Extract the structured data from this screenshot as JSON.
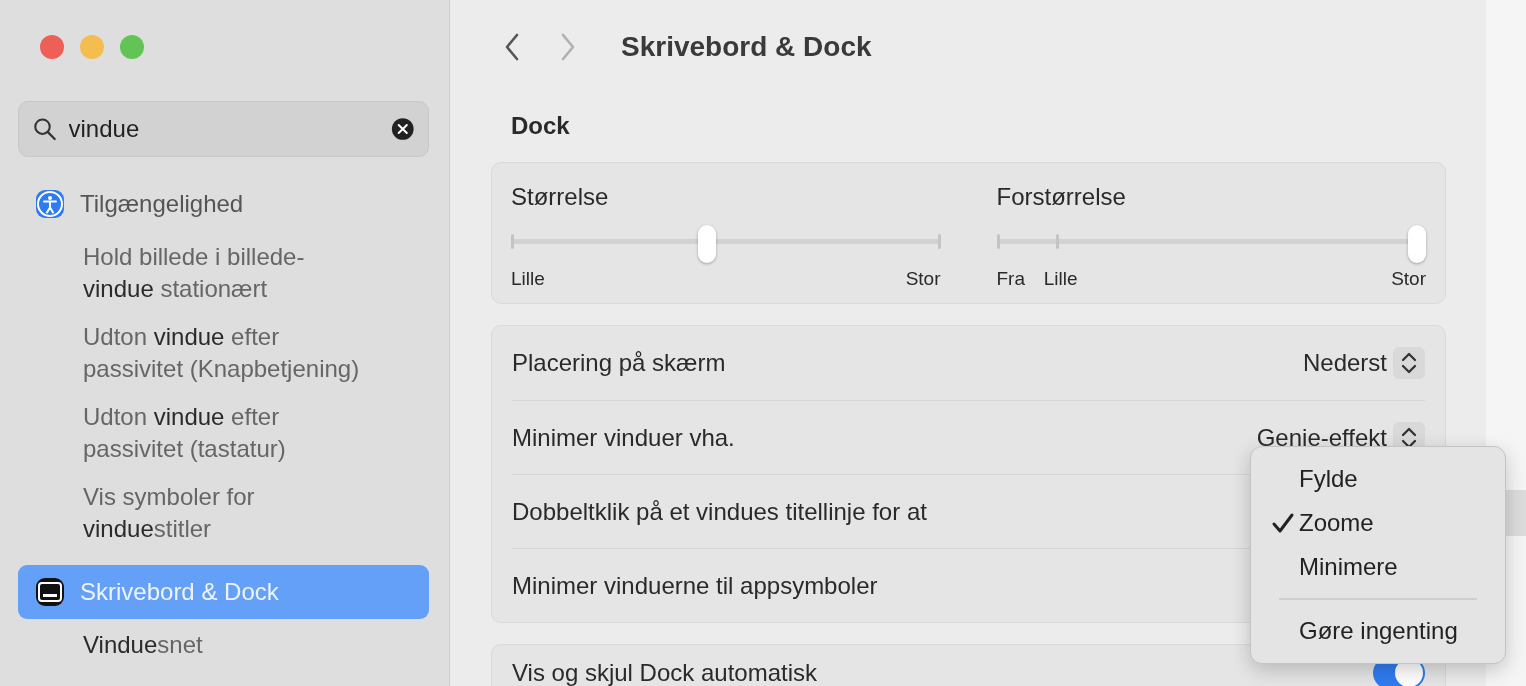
{
  "sidebar": {
    "search": {
      "value": "vindue"
    },
    "items": [
      {
        "label": "Tilgængelighed",
        "selected": false,
        "children": [
          {
            "label": "Hold billede i billede-**vindue** stationært"
          },
          {
            "label": "Udton **vindue** efter passivitet (Knapbetjening)"
          },
          {
            "label": "Udton **vindue** efter passivitet (tastatur)"
          },
          {
            "label": "Vis symboler for **vindue**stitler"
          }
        ]
      },
      {
        "label": "Skrivebord & Dock",
        "selected": true,
        "children": [
          {
            "label": "**Vindue**snet"
          }
        ]
      }
    ]
  },
  "header": {
    "back": {
      "disabled": false
    },
    "forward": {
      "disabled": true
    },
    "title": "Skrivebord & Dock"
  },
  "dock": {
    "title": "Dock",
    "sliders": [
      {
        "label": "Størrelse",
        "level": 0.455,
        "marks": [
          "Lille",
          "Stor"
        ]
      },
      {
        "label": "Forstørrelse",
        "level": 1,
        "marks": [
          "Fra",
          "Lille",
          "Stor"
        ]
      }
    ],
    "rows": [
      {
        "label": "Placering på skærm",
        "kind": "popup",
        "value": "Nederst"
      },
      {
        "label": "Minimer vinduer vha.",
        "kind": "popup",
        "value": "Genie-effekt"
      },
      {
        "label": "Dobbeltklik på et vindues titellinje for at"
      },
      {
        "label": "Minimer vinduerne til appsymboler"
      }
    ],
    "rows_2": [
      {
        "label": "Vis og skjul Dock automatisk",
        "kind": "toggle",
        "on": true
      }
    ]
  },
  "menu": {
    "items": [
      {
        "kind": "item",
        "label": "Fylde",
        "checked": false
      },
      {
        "kind": "item",
        "label": "Zoome",
        "checked": true
      },
      {
        "kind": "item",
        "label": "Minimere",
        "checked": false
      },
      {
        "kind": "separator"
      },
      {
        "kind": "item",
        "label": "Gøre ingenting",
        "checked": false
      }
    ]
  }
}
